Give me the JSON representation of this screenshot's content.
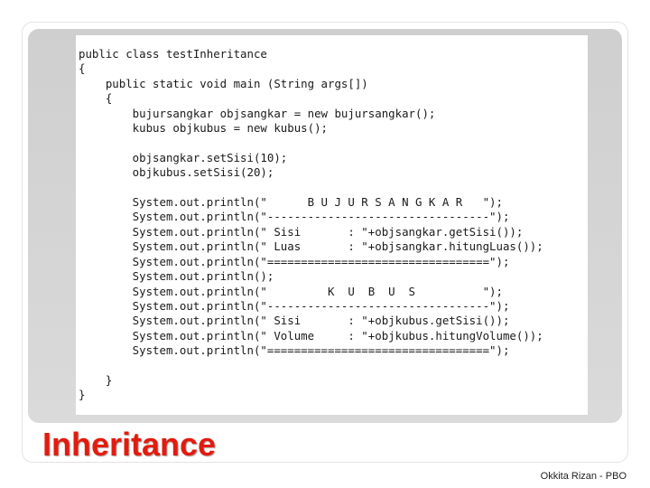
{
  "slide": {
    "code_lines": [
      "public class testInheritance",
      "{",
      "    public static void main (String args[])",
      "    {",
      "        bujursangkar objsangkar = new bujursangkar();",
      "        kubus objkubus = new kubus();",
      "",
      "        objsangkar.setSisi(10);",
      "        objkubus.setSisi(20);",
      "",
      "        System.out.println(\"      B U J U R S A N G K A R   \");",
      "        System.out.println(\"---------------------------------\");",
      "        System.out.println(\" Sisi       : \"+objsangkar.getSisi());",
      "        System.out.println(\" Luas       : \"+objsangkar.hitungLuas());",
      "        System.out.println(\"=================================\");",
      "        System.out.println();",
      "        System.out.println(\"         K  U  B  U  S          \");",
      "        System.out.println(\"---------------------------------\");",
      "        System.out.println(\" Sisi       : \"+objkubus.getSisi());",
      "        System.out.println(\" Volume     : \"+objkubus.hitungVolume());",
      "        System.out.println(\"=================================\");",
      "",
      "    }",
      "}"
    ],
    "title": "Inheritance",
    "footer": "Okkita Rizan - PBO"
  }
}
